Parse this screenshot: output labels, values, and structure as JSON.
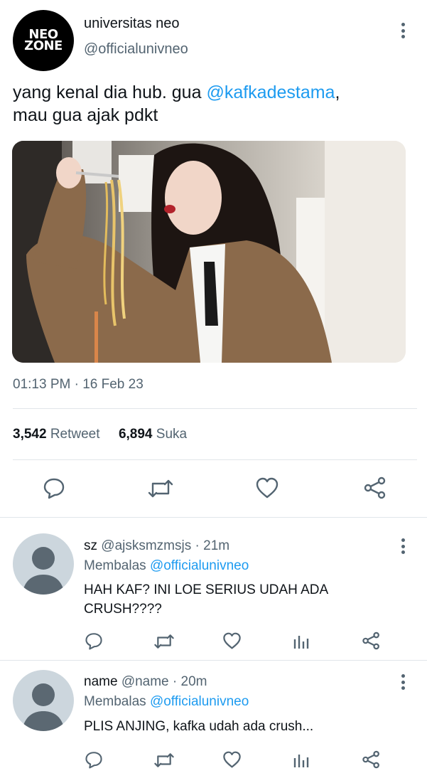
{
  "main_tweet": {
    "author_name": "universitas neo",
    "author_handle": "@officialunivneo",
    "avatar_logo_line1": "NEO",
    "avatar_logo_line2": "ZONE",
    "text_before_mention": "yang kenal dia hub. gua ",
    "mention": "@kafkadestama",
    "text_after_mention": ",",
    "text_line2": "mau gua ajak pdkt",
    "timestamp": "01:13 PM · 16 Feb 23",
    "retweet_count": "3,542",
    "retweet_label": "Retweet",
    "like_count": "6,894",
    "like_label": "Suka"
  },
  "replies": [
    {
      "name": "sz",
      "handle": "@ajsksmzmsjs",
      "time": "· 21m",
      "replying_prefix": "Membalas",
      "replying_to": "@officialunivneo",
      "text": "HAH KAF? INI LOE SERIUS UDAH ADA CRUSH????"
    },
    {
      "name": "name",
      "handle": "@name",
      "time": "· 20m",
      "replying_prefix": "Membalas",
      "replying_to": "@officialunivneo",
      "text": "PLIS ANJING, kafka udah ada crush..."
    }
  ],
  "icons": {
    "reply": "reply-icon",
    "retweet": "retweet-icon",
    "like": "heart-icon",
    "share": "share-icon",
    "analytics": "analytics-icon",
    "more": "more-vertical-icon"
  },
  "colors": {
    "accent": "#1d9bf0",
    "muted": "#536471",
    "text": "#0f1419",
    "divider": "#e1e6ea"
  }
}
